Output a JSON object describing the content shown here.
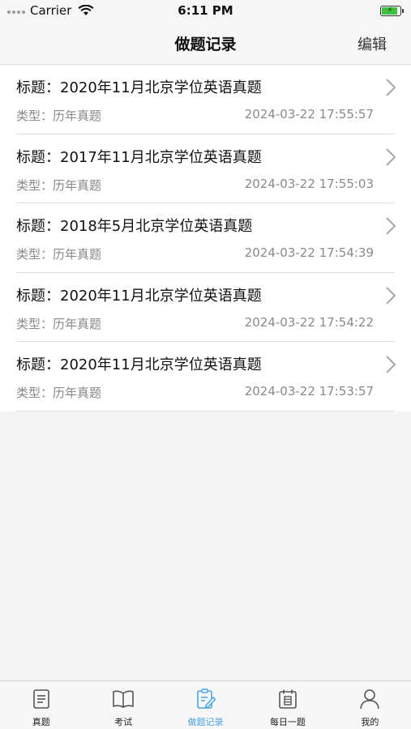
{
  "status_bar": {
    "carrier": "Carrier",
    "time": "6:11 PM"
  },
  "nav": {
    "title": "做题记录",
    "edit_label": "编辑"
  },
  "records": [
    {
      "title": "标题：2020年11月北京学位英语真题",
      "type": "类型：历年真题",
      "time": "2024-03-22 17:55:57"
    },
    {
      "title": "标题：2017年11月北京学位英语真题",
      "type": "类型：历年真题",
      "time": "2024-03-22 17:55:03"
    },
    {
      "title": "标题：2018年5月北京学位英语真题",
      "type": "类型：历年真题",
      "time": "2024-03-22 17:54:39"
    },
    {
      "title": "标题：2020年11月北京学位英语真题",
      "type": "类型：历年真题",
      "time": "2024-03-22 17:54:22"
    },
    {
      "title": "标题：2020年11月北京学位英语真题",
      "type": "类型：历年真题",
      "time": "2024-03-22 17:53:57"
    }
  ],
  "tabs": [
    {
      "label": "真题",
      "icon": "document-icon",
      "active": false
    },
    {
      "label": "考试",
      "icon": "book-icon",
      "active": false
    },
    {
      "label": "做题记录",
      "icon": "edit-note-icon",
      "active": true
    },
    {
      "label": "每日一题",
      "icon": "calendar-icon",
      "active": false
    },
    {
      "label": "我的",
      "icon": "user-icon",
      "active": false
    }
  ],
  "colors": {
    "accent": "#4aa3e6",
    "battery": "#3ec13e",
    "secondary_text": "#8a8a8a"
  }
}
